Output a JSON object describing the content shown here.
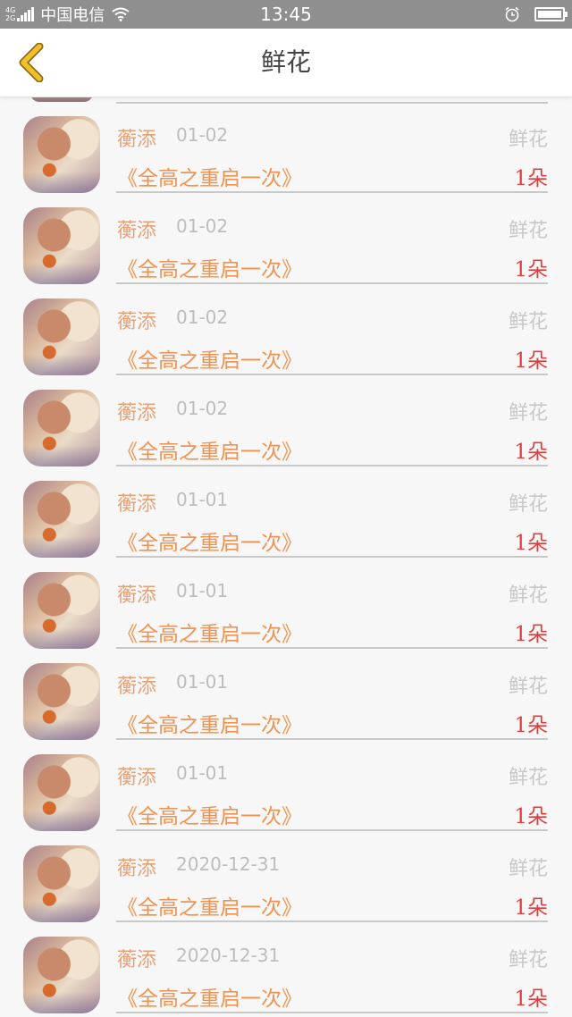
{
  "status_bar": {
    "network": "4G\n2G",
    "carrier": "中国电信",
    "time": "13:45"
  },
  "nav": {
    "title": "鲜花"
  },
  "colors": {
    "name": "#e5a277",
    "book": "#ee9353",
    "quantity": "#dd3f3f",
    "muted": "#bdbdbd",
    "back_arrow": "#e9b01c"
  },
  "rows": [
    {
      "name": "蘅添",
      "date": "01-02",
      "gift": "鲜花",
      "book": "《全高之重启一次》",
      "quantity": "1朵"
    },
    {
      "name": "蘅添",
      "date": "01-02",
      "gift": "鲜花",
      "book": "《全高之重启一次》",
      "quantity": "1朵"
    },
    {
      "name": "蘅添",
      "date": "01-02",
      "gift": "鲜花",
      "book": "《全高之重启一次》",
      "quantity": "1朵"
    },
    {
      "name": "蘅添",
      "date": "01-02",
      "gift": "鲜花",
      "book": "《全高之重启一次》",
      "quantity": "1朵"
    },
    {
      "name": "蘅添",
      "date": "01-01",
      "gift": "鲜花",
      "book": "《全高之重启一次》",
      "quantity": "1朵"
    },
    {
      "name": "蘅添",
      "date": "01-01",
      "gift": "鲜花",
      "book": "《全高之重启一次》",
      "quantity": "1朵"
    },
    {
      "name": "蘅添",
      "date": "01-01",
      "gift": "鲜花",
      "book": "《全高之重启一次》",
      "quantity": "1朵"
    },
    {
      "name": "蘅添",
      "date": "01-01",
      "gift": "鲜花",
      "book": "《全高之重启一次》",
      "quantity": "1朵"
    },
    {
      "name": "蘅添",
      "date": "2020-12-31",
      "gift": "鲜花",
      "book": "《全高之重启一次》",
      "quantity": "1朵"
    },
    {
      "name": "蘅添",
      "date": "2020-12-31",
      "gift": "鲜花",
      "book": "《全高之重启一次》",
      "quantity": "1朵"
    }
  ]
}
